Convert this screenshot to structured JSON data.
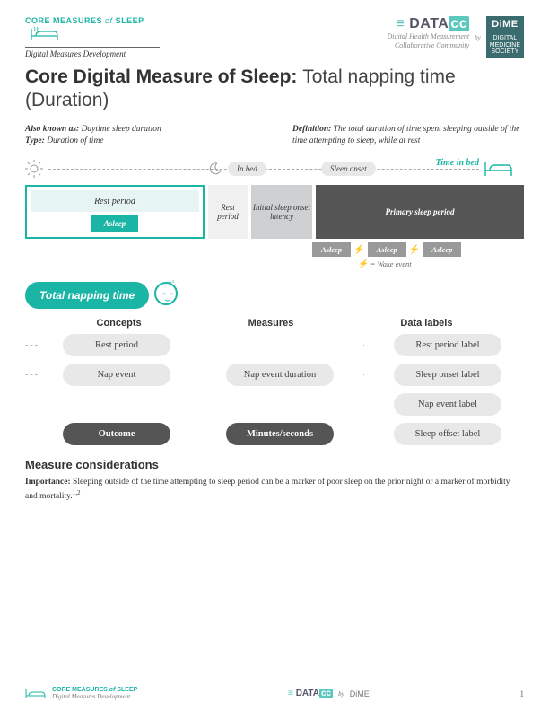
{
  "header": {
    "core_measures": "CORE MEASURES",
    "of": "of",
    "sleep": "SLEEP",
    "dmd": "Digital Measures Development",
    "datacc": "DATA",
    "datacc_cc": "cc",
    "datacc_sub1": "Digital Health Measurement",
    "datacc_sub2": "Collaborative Community",
    "by": "by",
    "dime1": "DiME",
    "dime2": "DIGITAL",
    "dime3": "MEDICINE",
    "dime4": "SOCIETY"
  },
  "title": {
    "bold": "Core Digital Measure of Sleep:",
    "thin": "Total napping time (Duration)"
  },
  "meta": {
    "aka_label": "Also known as:",
    "aka": "Daytime sleep duration",
    "type_label": "Type:",
    "type": "Duration of time",
    "def_label": "Definition:",
    "def": "The total duration of time spent sleeping outside of the time attempting to sleep, while at rest"
  },
  "timeline": {
    "in_bed": "In bed",
    "sleep_onset": "Sleep onset",
    "time_in_bed": "Time in bed"
  },
  "diagram": {
    "rest_period": "Rest period",
    "asleep": "Asleep",
    "rest_period2": "Rest period",
    "latency": "Initial sleep onset latency",
    "primary": "Primary sleep period",
    "wake_key": "= Wake event"
  },
  "tnt": {
    "label": "Total napping time"
  },
  "cmd": {
    "col1": "Concepts",
    "col2": "Measures",
    "col3": "Data labels",
    "rows": [
      {
        "c": "Rest period",
        "m": "",
        "d": "Rest period label"
      },
      {
        "c": "Nap event",
        "m": "Nap event duration",
        "d": "Sleep onset label"
      },
      {
        "c": "",
        "m": "",
        "d": "Nap event label"
      },
      {
        "c": "Outcome",
        "m": "Minutes/seconds",
        "d": "Sleep offset label"
      }
    ]
  },
  "considerations": {
    "heading": "Measure considerations",
    "imp_label": "Importance:",
    "imp": "Sleeping outside of the time attempting to sleep period can be a marker of poor sleep on the prior night or a marker of morbidity and mortality.",
    "refs": "1,2"
  },
  "footer": {
    "core": "CORE MEASURES",
    "of": "of",
    "sleep": "SLEEP",
    "dmd": "Digital Measures Development",
    "by": "by",
    "dime": "DiME",
    "page": "1"
  }
}
